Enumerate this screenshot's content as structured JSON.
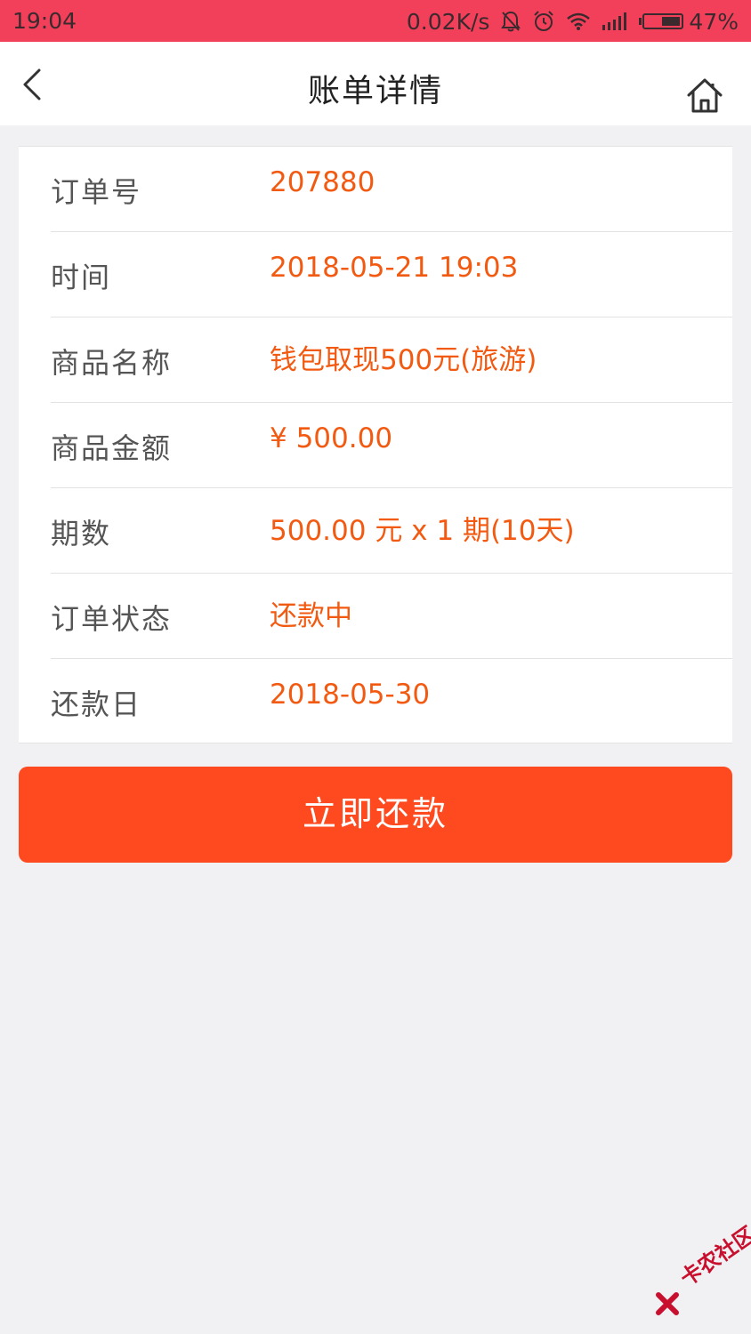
{
  "status_bar": {
    "time": "19:04",
    "net_speed": "0.02K/s",
    "battery_pct": "47%",
    "icons": [
      "bell-off-icon",
      "alarm-icon",
      "wifi-icon",
      "signal-icon",
      "battery-icon"
    ]
  },
  "nav": {
    "title": "账单详情",
    "back_icon": "back-arrow-icon",
    "home_icon": "home-icon"
  },
  "details": {
    "order_no": {
      "label": "订单号",
      "value": "207880"
    },
    "time": {
      "label": "时间",
      "value": "2018-05-21 19:03"
    },
    "product_name": {
      "label": "商品名称",
      "value": "钱包取现500元(旅游)"
    },
    "product_amount": {
      "label": "商品金额",
      "value": "¥ 500.00"
    },
    "installments": {
      "label": "期数",
      "value": "500.00 元 x 1 期(10天)"
    },
    "order_status": {
      "label": "订单状态",
      "value": "还款中"
    },
    "repay_date": {
      "label": "还款日",
      "value": "2018-05-30"
    }
  },
  "actions": {
    "repay_label": "立即还款"
  },
  "watermark": {
    "text": "卡农社区"
  },
  "colors": {
    "status_bar": "#f2405a",
    "accent": "#f25a12",
    "button": "#ff4a20",
    "background": "#f1f1f3"
  }
}
